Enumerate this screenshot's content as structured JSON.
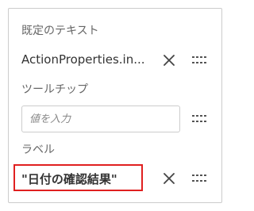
{
  "sections": {
    "default_text": {
      "label": "既定のテキスト",
      "value": "ActionProperties.in..."
    },
    "tooltip": {
      "label": "ツールチップ",
      "placeholder": "値を入力"
    },
    "label": {
      "label": "ラベル",
      "value": "\"日付の確認結果\""
    }
  },
  "icons": {
    "clear": "close-icon",
    "options": "more-options-icon"
  },
  "colors": {
    "highlight_border": "#e02020",
    "text": "#333333",
    "muted_text": "#666666",
    "border": "#cccccc"
  }
}
